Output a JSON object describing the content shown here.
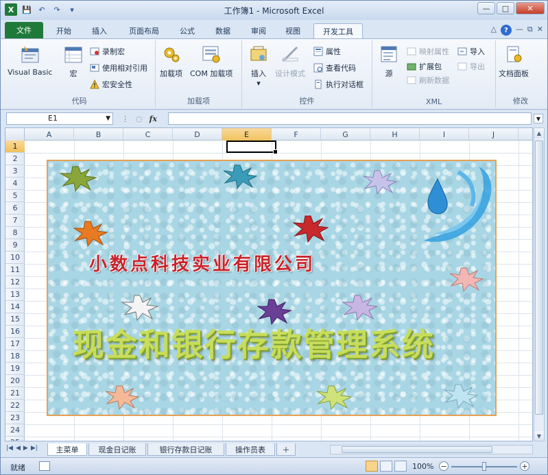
{
  "window": {
    "title": "工作簿1 - Microsoft Excel",
    "min_label": "—",
    "max_label": "□",
    "close_label": "✕"
  },
  "qat": {
    "logo": "X",
    "save": "💾",
    "undo": "↶",
    "redo": "↷",
    "customize": "▾"
  },
  "tabs": [
    {
      "label": "文件"
    },
    {
      "label": "开始"
    },
    {
      "label": "插入"
    },
    {
      "label": "页面布局"
    },
    {
      "label": "公式"
    },
    {
      "label": "数据"
    },
    {
      "label": "审阅"
    },
    {
      "label": "视图"
    },
    {
      "label": "开发工具"
    }
  ],
  "ribbon": {
    "code": {
      "label": "代码",
      "visual_basic": "Visual Basic",
      "macros": "宏",
      "record_macro": "录制宏",
      "relative_ref": "使用相对引用",
      "macro_security": "宏安全性"
    },
    "addins": {
      "label": "加载项",
      "addins": "加载项",
      "com_addins": "COM 加载项"
    },
    "controls": {
      "label": "控件",
      "insert": "插入",
      "design_mode": "设计模式",
      "properties": "属性",
      "view_code": "查看代码",
      "run_dialog": "执行对话框"
    },
    "xml": {
      "label": "XML",
      "source": "源",
      "map_properties": "映射属性",
      "expansion_packs": "扩展包",
      "refresh_data": "刷新数据",
      "import": "导入",
      "export": "导出"
    },
    "modify": {
      "label": "修改",
      "document_panel": "文档面板"
    }
  },
  "formula_bar": {
    "name_box": "E1",
    "fx": "fx",
    "content": ""
  },
  "columns": [
    "A",
    "B",
    "C",
    "D",
    "E",
    "F",
    "G",
    "H",
    "I",
    "J"
  ],
  "selected_column": "E",
  "rows": [
    "1",
    "2",
    "3",
    "4",
    "5",
    "6",
    "7",
    "8",
    "9",
    "10",
    "11",
    "12",
    "13",
    "14",
    "15",
    "16",
    "17",
    "18",
    "19",
    "20",
    "21",
    "22",
    "23",
    "24",
    "25"
  ],
  "selected_row": "1",
  "banner": {
    "company": "小数点科技实业有限公司",
    "system_title": "现金和银行存款管理系统",
    "border_color": "#e6a055",
    "background_color": "#a9d6e4"
  },
  "sheets": [
    {
      "label": "主菜单"
    },
    {
      "label": "现金日记账"
    },
    {
      "label": "银行存款日记账"
    },
    {
      "label": "操作员表"
    }
  ],
  "status": {
    "ready": "就绪",
    "zoom": "100%",
    "zoom_out": "−",
    "zoom_in": "+"
  },
  "colors": {
    "accent": "#1f7a3a",
    "selection": "#f1c15d",
    "company_text": "#c8232a",
    "title_text": "#c7dd5b"
  }
}
